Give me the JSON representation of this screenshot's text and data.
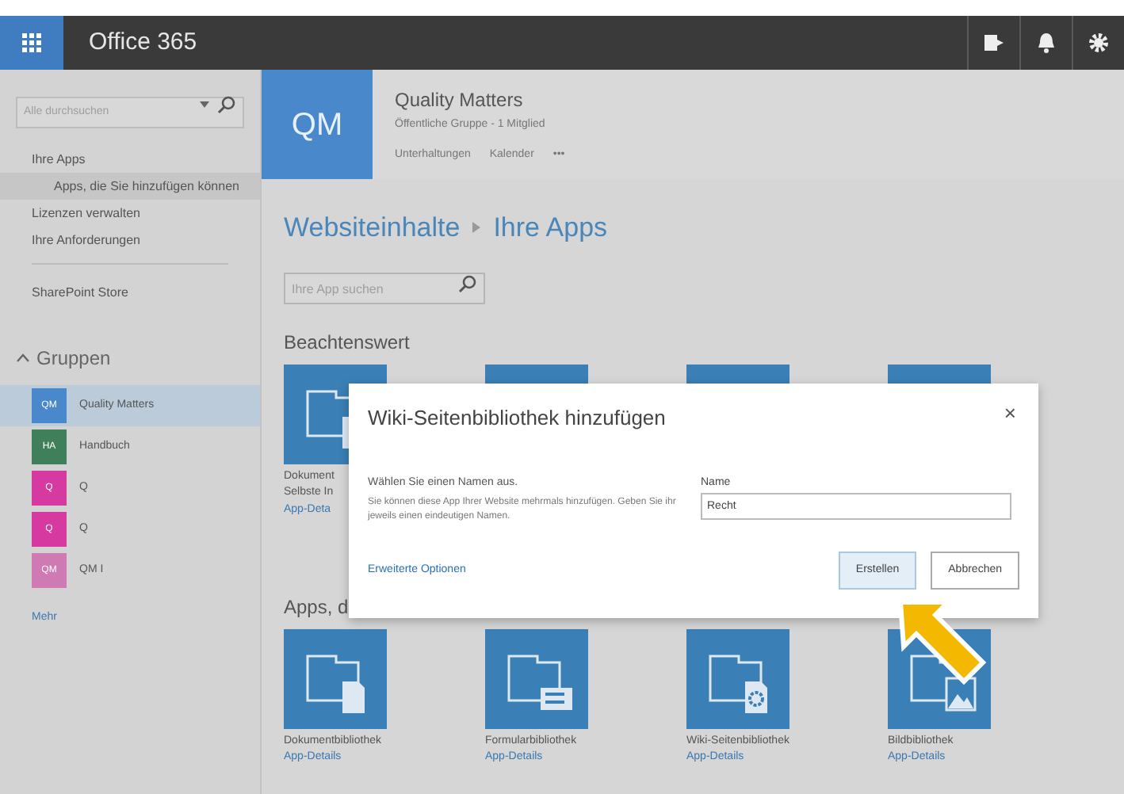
{
  "topbar": {
    "app_name": "Office 365"
  },
  "sidebar": {
    "search": {
      "placeholder": "Alle durchsuchen"
    },
    "items": [
      {
        "label": "Ihre Apps",
        "selected": false,
        "indented": false
      },
      {
        "label": "Apps, die Sie hinzufügen können",
        "selected": true,
        "indented": true
      },
      {
        "label": "Lizenzen verwalten",
        "selected": false,
        "indented": false
      },
      {
        "label": "Ihre Anforderungen",
        "selected": false,
        "indented": false
      }
    ],
    "store": "SharePoint Store",
    "groups_heading": "Gruppen",
    "groups": [
      {
        "initials": "QM",
        "name": "Quality Matters",
        "color": "#4a88cc",
        "selected": true
      },
      {
        "initials": "HA",
        "name": "Handbuch",
        "color": "#3f7f5a",
        "selected": false
      },
      {
        "initials": "Q",
        "name": "Q",
        "color": "#d63aa0",
        "selected": false
      },
      {
        "initials": "Q",
        "name": "Q",
        "color": "#d63aa0",
        "selected": false
      },
      {
        "initials": "QM",
        "name": "QM I",
        "color": "#d07ab4",
        "selected": false
      }
    ],
    "more": "Mehr"
  },
  "group_header": {
    "initials": "QM",
    "title": "Quality Matters",
    "subtitle": "Öffentliche Gruppe - 1 Mitglied",
    "links": [
      "Unterhaltungen",
      "Kalender",
      "•••"
    ]
  },
  "breadcrumb": [
    "Websiteinhalte",
    "Ihre Apps"
  ],
  "app_search": {
    "placeholder": "Ihre App suchen"
  },
  "sections": [
    {
      "heading": "Beachtenswert",
      "tiles": [
        {
          "kind": "document",
          "name": "Dokument",
          "description": "Selbste In",
          "link": "App-Deta"
        },
        {
          "kind": "hidden"
        },
        {
          "kind": "hidden"
        },
        {
          "kind": "hidden"
        }
      ]
    },
    {
      "heading": "Apps, d",
      "tiles": [
        {
          "kind": "document",
          "name": "Dokumentbibliothek",
          "link": "App-Details"
        },
        {
          "kind": "form",
          "name": "Formularbibliothek",
          "link": "App-Details"
        },
        {
          "kind": "wiki",
          "name": "Wiki-Seitenbibliothek",
          "link": "App-Details"
        },
        {
          "kind": "picture",
          "name": "Bildbibliothek",
          "link": "App-Details"
        }
      ]
    }
  ],
  "dialog": {
    "title": "Wiki-Seitenbibliothek hinzufügen",
    "close": "×",
    "prompt": "Wählen Sie einen Namen aus.",
    "hint": "Sie können diese App Ihrer Website mehrmals hinzufügen. Geben Sie ihr jeweils einen eindeutigen Namen.",
    "field_label": "Name",
    "field_value": "Recht",
    "advanced_link": "Erweiterte Optionen",
    "buttons": [
      {
        "label": "Erstellen",
        "focused": true
      },
      {
        "label": "Abbrechen",
        "focused": false
      }
    ]
  }
}
